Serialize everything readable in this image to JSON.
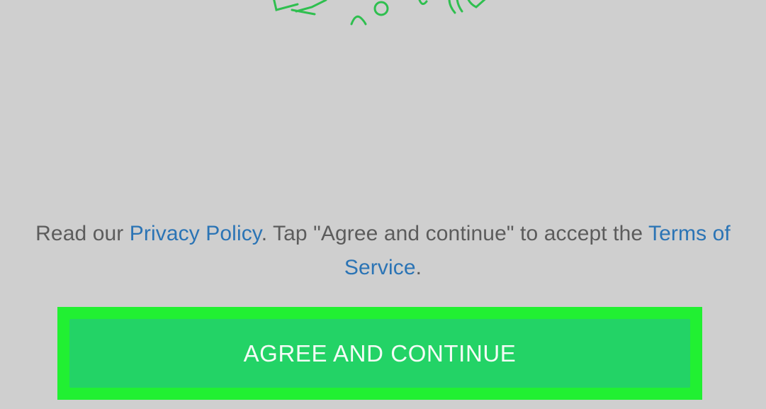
{
  "terms": {
    "prefix": "Read our ",
    "privacy_link": "Privacy Policy",
    "middle": ". Tap \"Agree and continue\" to accept the ",
    "terms_link": "Terms of Service",
    "suffix": "."
  },
  "agree_button": {
    "label": "AGREE AND CONTINUE"
  },
  "colors": {
    "background": "#cfcfcf",
    "link": "#2b74b5",
    "button": "#23d366",
    "highlight": "#21f032",
    "illustration": "#2fbf4f"
  },
  "icons": {
    "illustration": "doodle-illustration-icon"
  }
}
